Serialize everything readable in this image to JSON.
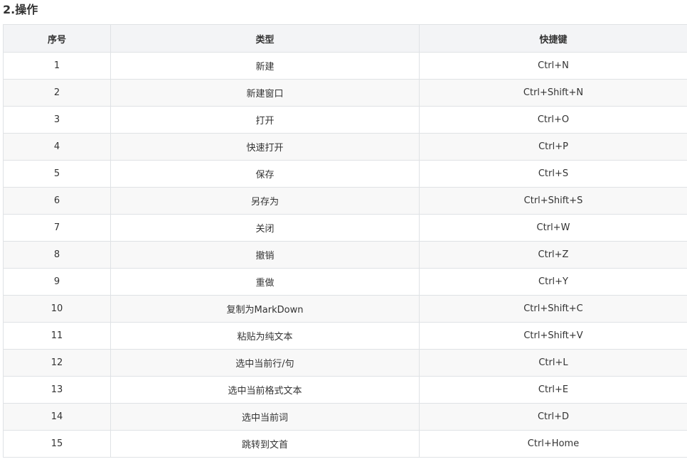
{
  "section": {
    "title": "2.操作"
  },
  "table": {
    "headers": [
      "序号",
      "类型",
      "快捷键"
    ],
    "rows": [
      [
        "1",
        "新建",
        "Ctrl+N"
      ],
      [
        "2",
        "新建窗口",
        "Ctrl+Shift+N"
      ],
      [
        "3",
        "打开",
        "Ctrl+O"
      ],
      [
        "4",
        "快速打开",
        "Ctrl+P"
      ],
      [
        "5",
        "保存",
        "Ctrl+S"
      ],
      [
        "6",
        "另存为",
        "Ctrl+Shift+S"
      ],
      [
        "7",
        "关闭",
        "Ctrl+W"
      ],
      [
        "8",
        "撤销",
        "Ctrl+Z"
      ],
      [
        "9",
        "重做",
        "Ctrl+Y"
      ],
      [
        "10",
        "复制为MarkDown",
        "Ctrl+Shift+C"
      ],
      [
        "11",
        "粘贴为纯文本",
        "Ctrl+Shift+V"
      ],
      [
        "12",
        "选中当前行/句",
        "Ctrl+L"
      ],
      [
        "13",
        "选中当前格式文本",
        "Ctrl+E"
      ],
      [
        "14",
        "选中当前词",
        "Ctrl+D"
      ],
      [
        "15",
        "跳转到文首",
        "Ctrl+Home"
      ]
    ]
  }
}
